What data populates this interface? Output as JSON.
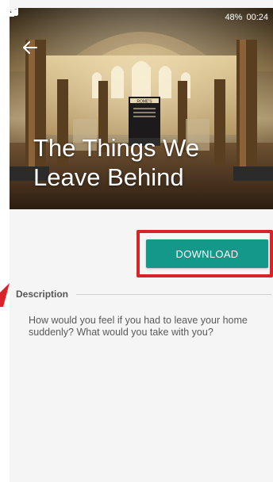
{
  "status_bar": {
    "battery": "48%",
    "time": "00:24",
    "icons": [
      "image-icon",
      "bluetooth-icon",
      "wifi-icon",
      "signal-icon",
      "battery-icon"
    ]
  },
  "hero": {
    "title": "The Things We Leave Behind",
    "back_icon": "arrow-left-icon",
    "sign_text": "ROME'S"
  },
  "actions": {
    "download_label": "DOWNLOAD",
    "download_color": "#139889",
    "highlight_color": "#d9232a"
  },
  "description": {
    "label": "Description",
    "text": "How would you feel if you had to leave your home suddenly? What would you take with you?"
  }
}
